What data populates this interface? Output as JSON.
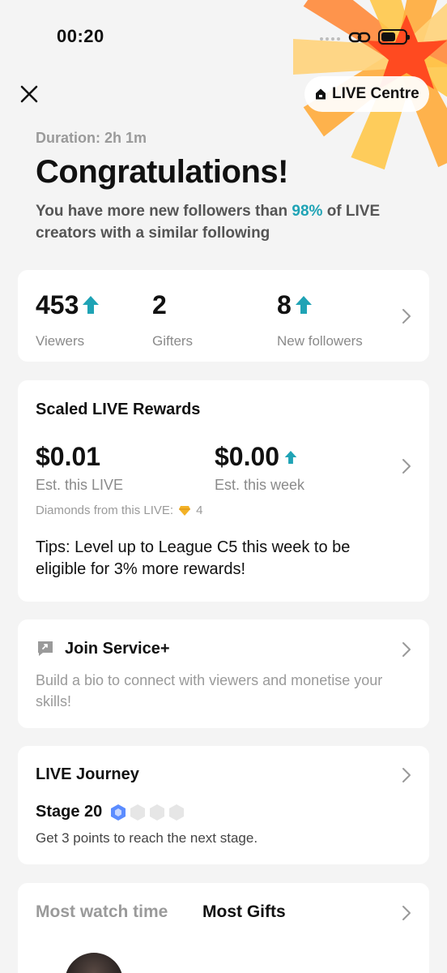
{
  "status_bar": {
    "time": "00:20"
  },
  "header": {
    "live_centre_label": "LIVE Centre"
  },
  "summary": {
    "duration": "Duration: 2h 1m",
    "title": "Congratulations!",
    "subtitle_prefix": "You have more new followers than ",
    "subtitle_highlight": "98%",
    "subtitle_suffix": " of LIVE creators with a similar following"
  },
  "stats": [
    {
      "value": "453",
      "label": "Viewers",
      "trend": "up"
    },
    {
      "value": "2",
      "label": "Gifters",
      "trend": "none"
    },
    {
      "value": "8",
      "label": "New followers",
      "trend": "up"
    }
  ],
  "rewards": {
    "title": "Scaled LIVE Rewards",
    "live_amount": "$0.01",
    "live_label": "Est. this LIVE",
    "week_amount": "$0.00",
    "week_label": "Est. this week",
    "diamonds_label": "Diamonds from this LIVE:",
    "diamonds_count": "4",
    "tips": "Tips: Level up to League C5 this week to be eligible for 3% more rewards!"
  },
  "service": {
    "title": "Join Service+",
    "description": "Build a bio to connect with viewers and monetise your skills!"
  },
  "journey": {
    "title": "LIVE Journey",
    "stage": "Stage 20",
    "description": "Get 3 points to reach the next stage."
  },
  "leaderboard": {
    "tabs": [
      "Most watch time",
      "Most Gifts"
    ],
    "active_tab": "Most Gifts"
  },
  "colors": {
    "accent_teal": "#1fa3b5",
    "burst_orange": "#ff6a2b",
    "burst_yellow": "#ffc84a",
    "stage_blue": "#5b8cff"
  },
  "icons": [
    "close-icon",
    "home-icon",
    "arrow-up-icon",
    "chevron-right-icon",
    "diamond-icon",
    "service-icon",
    "hexagon-icon",
    "link-icon",
    "battery-icon"
  ]
}
